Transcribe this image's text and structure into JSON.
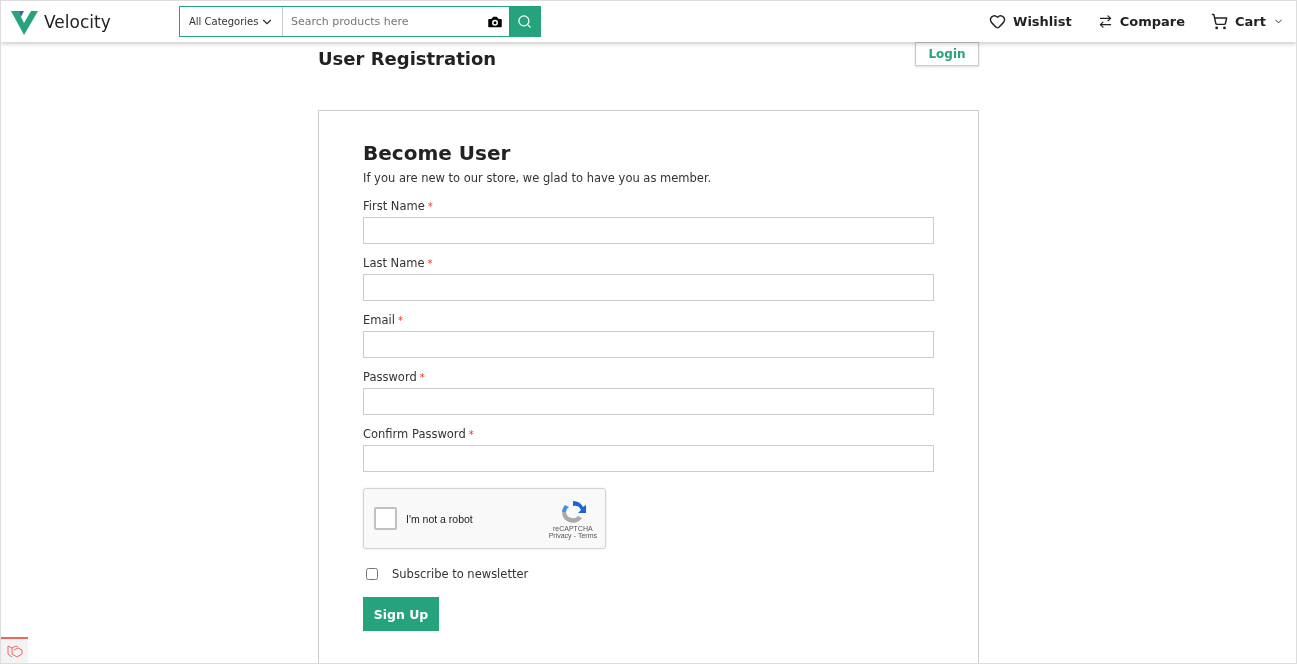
{
  "header": {
    "brand": "Velocity",
    "category": "All Categories",
    "search": {
      "placeholder": "Search products here"
    },
    "nav": [
      {
        "kind": "wishlist",
        "label": "Wishlist"
      },
      {
        "kind": "compare",
        "label": "Compare"
      },
      {
        "kind": "cart",
        "label": "Cart"
      }
    ]
  },
  "page_title": "User Registration",
  "login_button": "Login",
  "form": {
    "heading": "Become User",
    "intro": "If you are new to our store, we glad to have you as member.",
    "required_mark": "*",
    "fields": [
      {
        "label": "First Name",
        "required": true
      },
      {
        "label": "Last Name",
        "required": true
      },
      {
        "label": "Email",
        "required": true
      },
      {
        "label": "Password",
        "required": true
      },
      {
        "label": "Confirm Password",
        "required": true
      }
    ],
    "captcha": {
      "label": "I'm not a robot",
      "checked": false,
      "brand": "reCAPTCHA",
      "privacy": "Privacy",
      "separator": "-",
      "terms": "Terms"
    },
    "newsletter": {
      "label": "Subscribe to newsletter",
      "checked": false
    },
    "submit": "Sign Up"
  }
}
